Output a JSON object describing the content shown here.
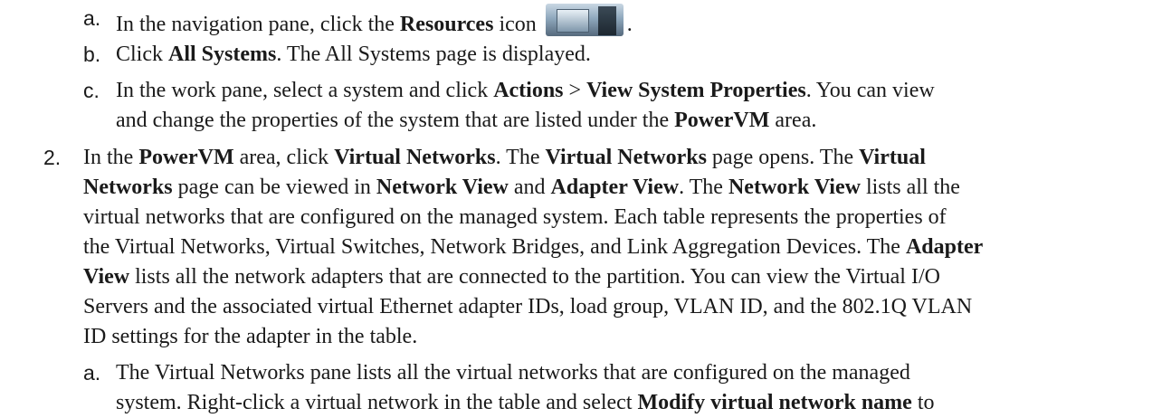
{
  "steps": {
    "a1": {
      "marker": "a.",
      "pre": "In the navigation pane, click the ",
      "bold": "Resources",
      "post": " icon",
      "end": ".",
      "icon": "resources-icon"
    },
    "b1": {
      "marker": "b.",
      "pre": "Click ",
      "bold": "All Systems",
      "post": ". The All Systems page is displayed."
    },
    "c1": {
      "marker": "c.",
      "l1_pre": "In the work pane, select a system and click ",
      "l1_b1": "Actions",
      "l1_sep": " > ",
      "l1_b2": "View System Properties",
      "l1_post": ". You can view",
      "l2_pre": "and change the properties of the system that are listed under the ",
      "l2_b": "PowerVM",
      "l2_post": " area."
    },
    "s2": {
      "marker": "2.",
      "l1_t1": "In the ",
      "l1_b1": "PowerVM",
      "l1_t2": " area, click ",
      "l1_b2": "Virtual Networks",
      "l1_t3": ". The ",
      "l1_b3": "Virtual Networks",
      "l1_t4": " page opens. The ",
      "l1_b4": "Virtual",
      "l2_b1": "Networks",
      "l2_t1": " page can be viewed in ",
      "l2_b2": "Network View",
      "l2_t2": " and ",
      "l2_b3": "Adapter View",
      "l2_t3": ". The ",
      "l2_b4": "Network View",
      "l2_t4": " lists all the",
      "l3": "virtual networks that are configured on the managed system. Each table represents the properties of",
      "l4_t1": "the Virtual Networks, Virtual Switches, Network Bridges, and Link Aggregation Devices. The ",
      "l4_b1": "Adapter",
      "l5_b1": "View",
      "l5_t1": " lists all the network adapters that are connected to the partition. You can view the Virtual I/O",
      "l6": "Servers and the associated virtual Ethernet adapter IDs, load group, VLAN ID, and the 802.1Q VLAN",
      "l7": "ID settings for the adapter in the table."
    },
    "a2": {
      "marker": "a.",
      "l1": "The Virtual Networks pane lists all the virtual networks that are configured on the managed",
      "l2_pre": "system. Right-click a virtual network in the table and select ",
      "l2_b": "Modify virtual network name",
      "l2_post": " to"
    }
  }
}
